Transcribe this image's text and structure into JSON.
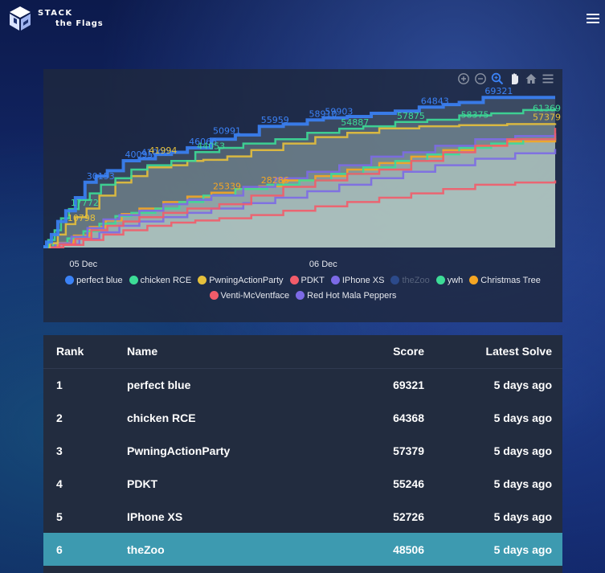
{
  "brand": {
    "line1": "STACK",
    "line2": "the Flags"
  },
  "chart_data": {
    "type": "line",
    "x_ticks": [
      "05 Dec",
      "06 Dec"
    ],
    "series": [
      {
        "name": "perfect blue",
        "color": "#3b82f6",
        "active": true,
        "points": [
          [
            0,
            360
          ],
          [
            4,
            2500
          ],
          [
            10,
            6000
          ],
          [
            18,
            12000
          ],
          [
            28,
            17000
          ],
          [
            40,
            23000
          ],
          [
            52,
            30153
          ],
          [
            66,
            33000
          ],
          [
            80,
            35500
          ],
          [
            100,
            40095
          ],
          [
            120,
            41000
          ],
          [
            140,
            43000
          ],
          [
            160,
            44000
          ],
          [
            180,
            46066
          ],
          [
            210,
            50000
          ],
          [
            240,
            52000
          ],
          [
            270,
            55959
          ],
          [
            300,
            57000
          ],
          [
            330,
            58910
          ],
          [
            350,
            59903
          ],
          [
            380,
            60500
          ],
          [
            410,
            62000
          ],
          [
            440,
            63000
          ],
          [
            470,
            64843
          ],
          [
            500,
            66000
          ],
          [
            520,
            67000
          ],
          [
            550,
            69321
          ],
          [
            640,
            69321
          ]
        ]
      },
      {
        "name": "chicken RCE",
        "color": "#3ddc97",
        "active": true,
        "points": [
          [
            0,
            300
          ],
          [
            6,
            3500
          ],
          [
            14,
            8000
          ],
          [
            22,
            13500
          ],
          [
            32,
            17772
          ],
          [
            44,
            22000
          ],
          [
            58,
            25000
          ],
          [
            72,
            29000
          ],
          [
            90,
            32000
          ],
          [
            110,
            36000
          ],
          [
            130,
            38000
          ],
          [
            160,
            40000
          ],
          [
            190,
            44053
          ],
          [
            220,
            46000
          ],
          [
            250,
            48000
          ],
          [
            290,
            50000
          ],
          [
            330,
            53000
          ],
          [
            370,
            54887
          ],
          [
            400,
            56000
          ],
          [
            440,
            58000
          ],
          [
            480,
            59000
          ],
          [
            520,
            61000
          ],
          [
            560,
            62000
          ],
          [
            600,
            63500
          ],
          [
            640,
            64368
          ]
        ]
      },
      {
        "name": "PwningActionParty",
        "color": "#e5c03c",
        "active": true,
        "points": [
          [
            0,
            200
          ],
          [
            8,
            2000
          ],
          [
            18,
            6000
          ],
          [
            28,
            10798
          ],
          [
            40,
            14000
          ],
          [
            54,
            18000
          ],
          [
            70,
            24000
          ],
          [
            90,
            30000
          ],
          [
            110,
            33000
          ],
          [
            130,
            37000
          ],
          [
            160,
            38000
          ],
          [
            180,
            40000
          ],
          [
            200,
            40500
          ],
          [
            230,
            42100
          ],
          [
            260,
            45000
          ],
          [
            300,
            48000
          ],
          [
            340,
            51000
          ],
          [
            380,
            53000
          ],
          [
            420,
            55000
          ],
          [
            470,
            56000
          ],
          [
            520,
            56500
          ],
          [
            580,
            57000
          ],
          [
            640,
            57379
          ]
        ]
      },
      {
        "name": "PDKT",
        "color": "#f25c6a",
        "active": true,
        "points": [
          [
            0,
            100
          ],
          [
            20,
            1500
          ],
          [
            40,
            4000
          ],
          [
            60,
            8000
          ],
          [
            80,
            10000
          ],
          [
            100,
            12000
          ],
          [
            120,
            14000
          ],
          [
            150,
            16000
          ],
          [
            180,
            18000
          ],
          [
            220,
            20000
          ],
          [
            260,
            24000
          ],
          [
            300,
            28000
          ],
          [
            340,
            31000
          ],
          [
            380,
            34000
          ],
          [
            420,
            36000
          ],
          [
            460,
            40000
          ],
          [
            500,
            44000
          ],
          [
            540,
            47000
          ],
          [
            580,
            50000
          ],
          [
            640,
            55246
          ]
        ]
      },
      {
        "name": "IPhone XS",
        "color": "#7c6ae6",
        "active": true,
        "points": [
          [
            0,
            150
          ],
          [
            15,
            2000
          ],
          [
            35,
            5000
          ],
          [
            55,
            9000
          ],
          [
            75,
            13000
          ],
          [
            95,
            15000
          ],
          [
            120,
            17000
          ],
          [
            150,
            20000
          ],
          [
            180,
            22000
          ],
          [
            210,
            24000
          ],
          [
            250,
            28000
          ],
          [
            290,
            32000
          ],
          [
            330,
            35000
          ],
          [
            370,
            38000
          ],
          [
            410,
            42000
          ],
          [
            450,
            44000
          ],
          [
            490,
            47000
          ],
          [
            540,
            50000
          ],
          [
            590,
            51500
          ],
          [
            640,
            52726
          ]
        ]
      },
      {
        "name": "theZoo",
        "color": "#2c4a8a",
        "active": false,
        "points": []
      },
      {
        "name": "ywh",
        "color": "#3ddc97",
        "active": true,
        "points": [
          [
            0,
            120
          ],
          [
            12,
            1800
          ],
          [
            30,
            4200
          ],
          [
            50,
            7500
          ],
          [
            70,
            11000
          ],
          [
            90,
            14500
          ],
          [
            110,
            16000
          ],
          [
            140,
            18000
          ],
          [
            170,
            21000
          ],
          [
            200,
            24000
          ],
          [
            240,
            27000
          ],
          [
            280,
            29000
          ],
          [
            320,
            31000
          ],
          [
            360,
            34000
          ],
          [
            400,
            37000
          ],
          [
            440,
            40000
          ],
          [
            480,
            43000
          ],
          [
            520,
            46000
          ],
          [
            560,
            48000
          ],
          [
            600,
            50000
          ],
          [
            640,
            51500
          ]
        ]
      },
      {
        "name": "Christmas Tree",
        "color": "#f5a623",
        "active": true,
        "points": [
          [
            0,
            110
          ],
          [
            18,
            2200
          ],
          [
            38,
            5500
          ],
          [
            58,
            9500
          ],
          [
            78,
            12500
          ],
          [
            98,
            15500
          ],
          [
            120,
            18000
          ],
          [
            150,
            21000
          ],
          [
            180,
            23500
          ],
          [
            210,
            25339
          ],
          [
            240,
            27000
          ],
          [
            270,
            28286
          ],
          [
            300,
            31000
          ],
          [
            340,
            33000
          ],
          [
            380,
            36000
          ],
          [
            420,
            39000
          ],
          [
            460,
            42000
          ],
          [
            500,
            45000
          ],
          [
            540,
            47000
          ],
          [
            580,
            49000
          ],
          [
            640,
            50500
          ]
        ]
      },
      {
        "name": "Venti-McVentface",
        "color": "#f25c6a",
        "active": true,
        "points": [
          [
            0,
            80
          ],
          [
            25,
            1200
          ],
          [
            50,
            3500
          ],
          [
            75,
            6000
          ],
          [
            100,
            8000
          ],
          [
            130,
            10000
          ],
          [
            160,
            11500
          ],
          [
            190,
            12500
          ],
          [
            220,
            13500
          ],
          [
            260,
            15000
          ],
          [
            300,
            17000
          ],
          [
            340,
            19000
          ],
          [
            380,
            21000
          ],
          [
            420,
            23000
          ],
          [
            460,
            25000
          ],
          [
            500,
            27000
          ],
          [
            540,
            29000
          ],
          [
            590,
            30000
          ],
          [
            640,
            31000
          ]
        ]
      },
      {
        "name": "Red Hot Mala Peppers",
        "color": "#7c6ae6",
        "active": true,
        "points": [
          [
            0,
            90
          ],
          [
            20,
            1500
          ],
          [
            45,
            4000
          ],
          [
            70,
            7000
          ],
          [
            95,
            10000
          ],
          [
            120,
            12000
          ],
          [
            150,
            14000
          ],
          [
            180,
            16000
          ],
          [
            210,
            18000
          ],
          [
            250,
            20500
          ],
          [
            290,
            23000
          ],
          [
            330,
            26000
          ],
          [
            370,
            29000
          ],
          [
            410,
            32000
          ],
          [
            450,
            35000
          ],
          [
            490,
            38000
          ],
          [
            540,
            41000
          ],
          [
            590,
            43500
          ],
          [
            640,
            45500
          ]
        ]
      }
    ],
    "point_labels": [
      {
        "series": "perfect blue",
        "x": 52,
        "y": 30153
      },
      {
        "series": "perfect blue",
        "x": 100,
        "y": 40095
      },
      {
        "series": "perfect blue",
        "x": 120,
        "y": 41000
      },
      {
        "series": "perfect blue",
        "x": 180,
        "y": 46066
      },
      {
        "series": "perfect blue",
        "x": 210,
        "y": 50991
      },
      {
        "series": "perfect blue",
        "x": 270,
        "y": 55959
      },
      {
        "series": "perfect blue",
        "x": 330,
        "y": 58910
      },
      {
        "series": "perfect blue",
        "x": 350,
        "y": 59903
      },
      {
        "series": "perfect blue",
        "x": 470,
        "y": 64843
      },
      {
        "series": "perfect blue",
        "x": 550,
        "y": 69321
      },
      {
        "series": "chicken RCE",
        "x": 32,
        "y": 17772
      },
      {
        "series": "chicken RCE",
        "x": 190,
        "y": 44053
      },
      {
        "series": "chicken RCE",
        "x": 370,
        "y": 54887
      },
      {
        "series": "chicken RCE",
        "x": 640,
        "y": 61369
      },
      {
        "series": "PwningActionParty",
        "x": 28,
        "y": 10798
      },
      {
        "series": "PwningActionParty",
        "x": 130,
        "y": 41994
      },
      {
        "series": "PwningActionParty",
        "x": 640,
        "y": 57379
      },
      {
        "series": "Christmas Tree",
        "x": 210,
        "y": 25339
      },
      {
        "series": "Christmas Tree",
        "x": 270,
        "y": 28286
      },
      {
        "series": "chicken RCE",
        "x": 440,
        "y": 57875
      },
      {
        "series": "chicken RCE",
        "x": 520,
        "y": 58375
      }
    ],
    "xlim": [
      0,
      640
    ],
    "ylim": [
      0,
      72000
    ],
    "grid": false,
    "legend_position": "bottom"
  },
  "toolbox": {
    "zoom_in": "zoom-in-icon",
    "zoom_out": "zoom-out-icon",
    "zoom_reset": "zoom-reset-icon",
    "pan": "pan-hand-icon",
    "home": "home-icon",
    "menu": "menu-icon"
  },
  "table": {
    "headers": {
      "rank": "Rank",
      "name": "Name",
      "score": "Score",
      "latest": "Latest Solve"
    },
    "rows": [
      {
        "rank": "1",
        "name": "perfect blue",
        "score": "69321",
        "latest": "5 days ago"
      },
      {
        "rank": "2",
        "name": "chicken RCE",
        "score": "64368",
        "latest": "5 days ago"
      },
      {
        "rank": "3",
        "name": "PwningActionParty",
        "score": "57379",
        "latest": "5 days ago"
      },
      {
        "rank": "4",
        "name": "PDKT",
        "score": "55246",
        "latest": "5 days ago"
      },
      {
        "rank": "5",
        "name": "IPhone XS",
        "score": "52726",
        "latest": "5 days ago"
      },
      {
        "rank": "6",
        "name": "theZoo",
        "score": "48506",
        "latest": "5 days ago"
      }
    ],
    "highlight_color": "#3d9ab0"
  }
}
